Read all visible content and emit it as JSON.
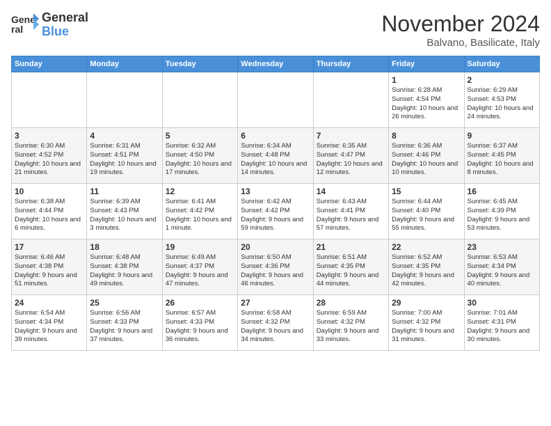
{
  "header": {
    "logo_line1": "General",
    "logo_line2": "Blue",
    "month": "November 2024",
    "location": "Balvano, Basilicate, Italy"
  },
  "days_of_week": [
    "Sunday",
    "Monday",
    "Tuesday",
    "Wednesday",
    "Thursday",
    "Friday",
    "Saturday"
  ],
  "weeks": [
    [
      {
        "day": "",
        "info": ""
      },
      {
        "day": "",
        "info": ""
      },
      {
        "day": "",
        "info": ""
      },
      {
        "day": "",
        "info": ""
      },
      {
        "day": "",
        "info": ""
      },
      {
        "day": "1",
        "info": "Sunrise: 6:28 AM\nSunset: 4:54 PM\nDaylight: 10 hours and 26 minutes."
      },
      {
        "day": "2",
        "info": "Sunrise: 6:29 AM\nSunset: 4:53 PM\nDaylight: 10 hours and 24 minutes."
      }
    ],
    [
      {
        "day": "3",
        "info": "Sunrise: 6:30 AM\nSunset: 4:52 PM\nDaylight: 10 hours and 21 minutes."
      },
      {
        "day": "4",
        "info": "Sunrise: 6:31 AM\nSunset: 4:51 PM\nDaylight: 10 hours and 19 minutes."
      },
      {
        "day": "5",
        "info": "Sunrise: 6:32 AM\nSunset: 4:50 PM\nDaylight: 10 hours and 17 minutes."
      },
      {
        "day": "6",
        "info": "Sunrise: 6:34 AM\nSunset: 4:48 PM\nDaylight: 10 hours and 14 minutes."
      },
      {
        "day": "7",
        "info": "Sunrise: 6:35 AM\nSunset: 4:47 PM\nDaylight: 10 hours and 12 minutes."
      },
      {
        "day": "8",
        "info": "Sunrise: 6:36 AM\nSunset: 4:46 PM\nDaylight: 10 hours and 10 minutes."
      },
      {
        "day": "9",
        "info": "Sunrise: 6:37 AM\nSunset: 4:45 PM\nDaylight: 10 hours and 8 minutes."
      }
    ],
    [
      {
        "day": "10",
        "info": "Sunrise: 6:38 AM\nSunset: 4:44 PM\nDaylight: 10 hours and 6 minutes."
      },
      {
        "day": "11",
        "info": "Sunrise: 6:39 AM\nSunset: 4:43 PM\nDaylight: 10 hours and 3 minutes."
      },
      {
        "day": "12",
        "info": "Sunrise: 6:41 AM\nSunset: 4:42 PM\nDaylight: 10 hours and 1 minute."
      },
      {
        "day": "13",
        "info": "Sunrise: 6:42 AM\nSunset: 4:42 PM\nDaylight: 9 hours and 59 minutes."
      },
      {
        "day": "14",
        "info": "Sunrise: 6:43 AM\nSunset: 4:41 PM\nDaylight: 9 hours and 57 minutes."
      },
      {
        "day": "15",
        "info": "Sunrise: 6:44 AM\nSunset: 4:40 PM\nDaylight: 9 hours and 55 minutes."
      },
      {
        "day": "16",
        "info": "Sunrise: 6:45 AM\nSunset: 4:39 PM\nDaylight: 9 hours and 53 minutes."
      }
    ],
    [
      {
        "day": "17",
        "info": "Sunrise: 6:46 AM\nSunset: 4:38 PM\nDaylight: 9 hours and 51 minutes."
      },
      {
        "day": "18",
        "info": "Sunrise: 6:48 AM\nSunset: 4:38 PM\nDaylight: 9 hours and 49 minutes."
      },
      {
        "day": "19",
        "info": "Sunrise: 6:49 AM\nSunset: 4:37 PM\nDaylight: 9 hours and 47 minutes."
      },
      {
        "day": "20",
        "info": "Sunrise: 6:50 AM\nSunset: 4:36 PM\nDaylight: 9 hours and 46 minutes."
      },
      {
        "day": "21",
        "info": "Sunrise: 6:51 AM\nSunset: 4:35 PM\nDaylight: 9 hours and 44 minutes."
      },
      {
        "day": "22",
        "info": "Sunrise: 6:52 AM\nSunset: 4:35 PM\nDaylight: 9 hours and 42 minutes."
      },
      {
        "day": "23",
        "info": "Sunrise: 6:53 AM\nSunset: 4:34 PM\nDaylight: 9 hours and 40 minutes."
      }
    ],
    [
      {
        "day": "24",
        "info": "Sunrise: 6:54 AM\nSunset: 4:34 PM\nDaylight: 9 hours and 39 minutes."
      },
      {
        "day": "25",
        "info": "Sunrise: 6:56 AM\nSunset: 4:33 PM\nDaylight: 9 hours and 37 minutes."
      },
      {
        "day": "26",
        "info": "Sunrise: 6:57 AM\nSunset: 4:33 PM\nDaylight: 9 hours and 36 minutes."
      },
      {
        "day": "27",
        "info": "Sunrise: 6:58 AM\nSunset: 4:32 PM\nDaylight: 9 hours and 34 minutes."
      },
      {
        "day": "28",
        "info": "Sunrise: 6:59 AM\nSunset: 4:32 PM\nDaylight: 9 hours and 33 minutes."
      },
      {
        "day": "29",
        "info": "Sunrise: 7:00 AM\nSunset: 4:32 PM\nDaylight: 9 hours and 31 minutes."
      },
      {
        "day": "30",
        "info": "Sunrise: 7:01 AM\nSunset: 4:31 PM\nDaylight: 9 hours and 30 minutes."
      }
    ]
  ]
}
